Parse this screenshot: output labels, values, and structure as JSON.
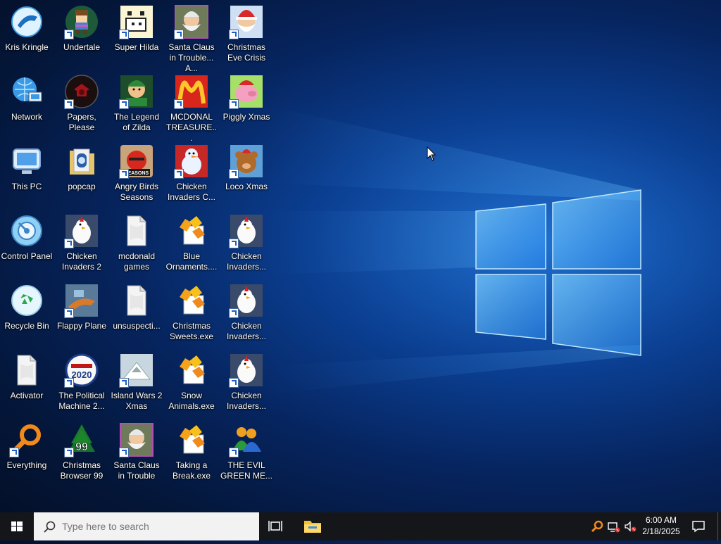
{
  "desktop": {
    "icons": [
      {
        "label": "Kris Kringle",
        "kind": "kris-kringle-icon",
        "shortcut": false
      },
      {
        "label": "Network",
        "kind": "network-icon",
        "shortcut": false
      },
      {
        "label": "This PC",
        "kind": "computer-icon",
        "shortcut": false
      },
      {
        "label": "Control Panel",
        "kind": "control-panel-icon",
        "shortcut": false
      },
      {
        "label": "Recycle Bin",
        "kind": "recycle-bin-icon",
        "shortcut": false
      },
      {
        "label": "Activator",
        "kind": "file-icon",
        "shortcut": false
      },
      {
        "label": "Everything",
        "kind": "everything-search-icon",
        "shortcut": true
      },
      {
        "label": "Undertale",
        "kind": "undertale-icon",
        "shortcut": true
      },
      {
        "label": "Papers, Please",
        "kind": "papers-please-icon",
        "shortcut": true
      },
      {
        "label": "popcap",
        "kind": "folder-icon",
        "shortcut": false
      },
      {
        "label": "Chicken Invaders 2",
        "kind": "chicken-invaders-icon",
        "shortcut": true
      },
      {
        "label": "Flappy Plane",
        "kind": "flappy-plane-icon",
        "shortcut": true
      },
      {
        "label": "The Political Machine 2...",
        "kind": "political-machine-icon",
        "shortcut": true
      },
      {
        "label": "Christmas Browser 99",
        "kind": "christmas-browser-icon",
        "shortcut": true
      },
      {
        "label": "Super Hilda",
        "kind": "super-hilda-icon",
        "shortcut": true
      },
      {
        "label": "The Legend of Zilda",
        "kind": "legend-of-zilda-icon",
        "shortcut": true
      },
      {
        "label": "Angry Birds Seasons",
        "kind": "angry-birds-icon",
        "shortcut": true
      },
      {
        "label": "mcdonald games",
        "kind": "file-icon",
        "shortcut": false
      },
      {
        "label": "unsuspecti...",
        "kind": "file-icon",
        "shortcut": false
      },
      {
        "label": "Island Wars 2 Xmas",
        "kind": "island-wars-icon",
        "shortcut": true
      },
      {
        "label": "Santa Claus in Trouble",
        "kind": "santa-trouble-icon",
        "shortcut": true
      },
      {
        "label": "Santa Claus in Trouble... A...",
        "kind": "santa-trouble-icon",
        "shortcut": true
      },
      {
        "label": "MCDONAL TREASURE...",
        "kind": "mcdonalds-icon",
        "shortcut": true
      },
      {
        "label": "Chicken Invaders C...",
        "kind": "snowman-icon",
        "shortcut": true
      },
      {
        "label": "Blue Ornaments....",
        "kind": "exe-icon",
        "shortcut": false
      },
      {
        "label": "Christmas Sweets.exe",
        "kind": "exe-icon",
        "shortcut": false
      },
      {
        "label": "Snow Animals.exe",
        "kind": "exe-icon",
        "shortcut": false
      },
      {
        "label": "Taking a Break.exe",
        "kind": "exe-icon",
        "shortcut": false
      },
      {
        "label": "Christmas Eve Crisis",
        "kind": "santa-icon",
        "shortcut": true
      },
      {
        "label": "Piggly Xmas",
        "kind": "piggly-icon",
        "shortcut": true
      },
      {
        "label": "Loco Xmas",
        "kind": "teddy-bear-icon",
        "shortcut": true
      },
      {
        "label": "Chicken Invaders...",
        "kind": "chicken-invaders-icon",
        "shortcut": true
      },
      {
        "label": "Chicken Invaders...",
        "kind": "chicken-invaders-icon",
        "shortcut": true
      },
      {
        "label": "Chicken Invaders...",
        "kind": "chicken-invaders-icon",
        "shortcut": true
      },
      {
        "label": "THE EVIL GREEN ME...",
        "kind": "messenger-icon",
        "shortcut": true
      }
    ]
  },
  "taskbar": {
    "search_placeholder": "Type here to search",
    "time": "6:00 AM",
    "date": "2/18/2025"
  },
  "colors": {
    "taskbar_bg": "#15161a",
    "windows_blue": "#1a8cff"
  }
}
